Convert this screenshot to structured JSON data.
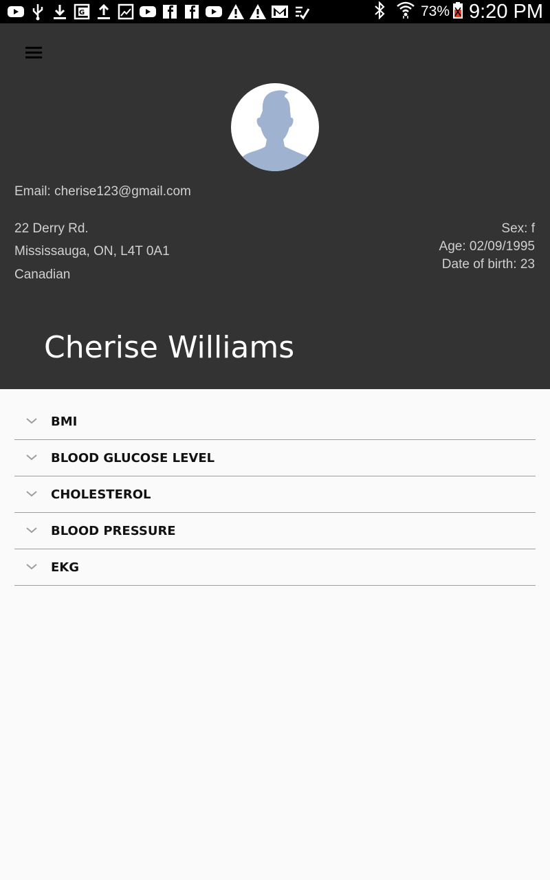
{
  "status_bar": {
    "notification_icons": [
      "youtube-icon",
      "usb-icon",
      "download-icon",
      "google-plus-icon",
      "upload-icon",
      "image-icon",
      "youtube-icon",
      "facebook-icon",
      "facebook-icon",
      "youtube-icon",
      "warning-icon",
      "warning-icon",
      "gmail-icon",
      "checklist-icon"
    ],
    "battery_percent": "73%",
    "time": "9:20 PM"
  },
  "header": {
    "menu_icon": "hamburger-menu-icon",
    "avatar_icon": "default-avatar-icon",
    "email": "Email: cherise123@gmail.com",
    "address": {
      "line1": "22 Derry Rd.",
      "line2": "Mississauga, ON, L4T 0A1",
      "line3": "Canadian"
    },
    "details": {
      "sex": "Sex: f",
      "age": "Age: 02/09/1995",
      "dob": "Date of birth: 23"
    },
    "name": "Cherise Williams"
  },
  "accordion": {
    "items": [
      {
        "label": "BMI"
      },
      {
        "label": "BLOOD GLUCOSE LEVEL"
      },
      {
        "label": "CHOLESTEROL"
      },
      {
        "label": "BLOOD PRESSURE"
      },
      {
        "label": "EKG"
      }
    ]
  },
  "colors": {
    "header_bg": "#333333",
    "page_bg": "#fafafa",
    "avatar_silhouette": "#9fb3d0"
  }
}
